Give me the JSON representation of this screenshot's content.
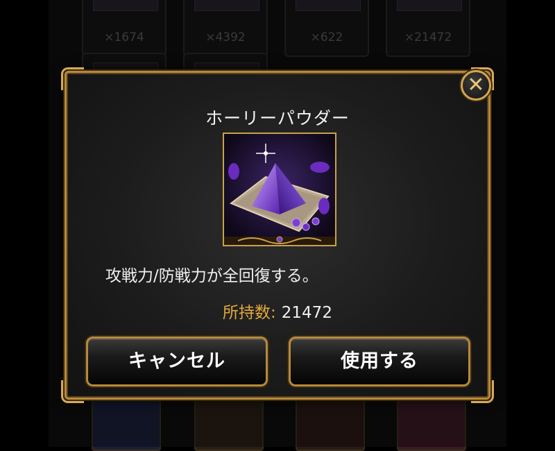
{
  "background": {
    "slots": [
      {
        "count": "×1674"
      },
      {
        "count": "×4392"
      },
      {
        "count": "×622"
      },
      {
        "count": "×21472"
      }
    ]
  },
  "dialog": {
    "title": "ホーリーパウダー",
    "item_icon": "holy-powder-icon",
    "description": "攻戦力/防戦力が全回復する。",
    "owned_label": "所持数:",
    "owned_value": "21472",
    "cancel_label": "キャンセル",
    "use_label": "使用する",
    "close_icon": "close-icon"
  },
  "colors": {
    "gold_border": "#b8893a",
    "owned_label": "#e3a93b",
    "item_purple": "#7b3fd1"
  }
}
